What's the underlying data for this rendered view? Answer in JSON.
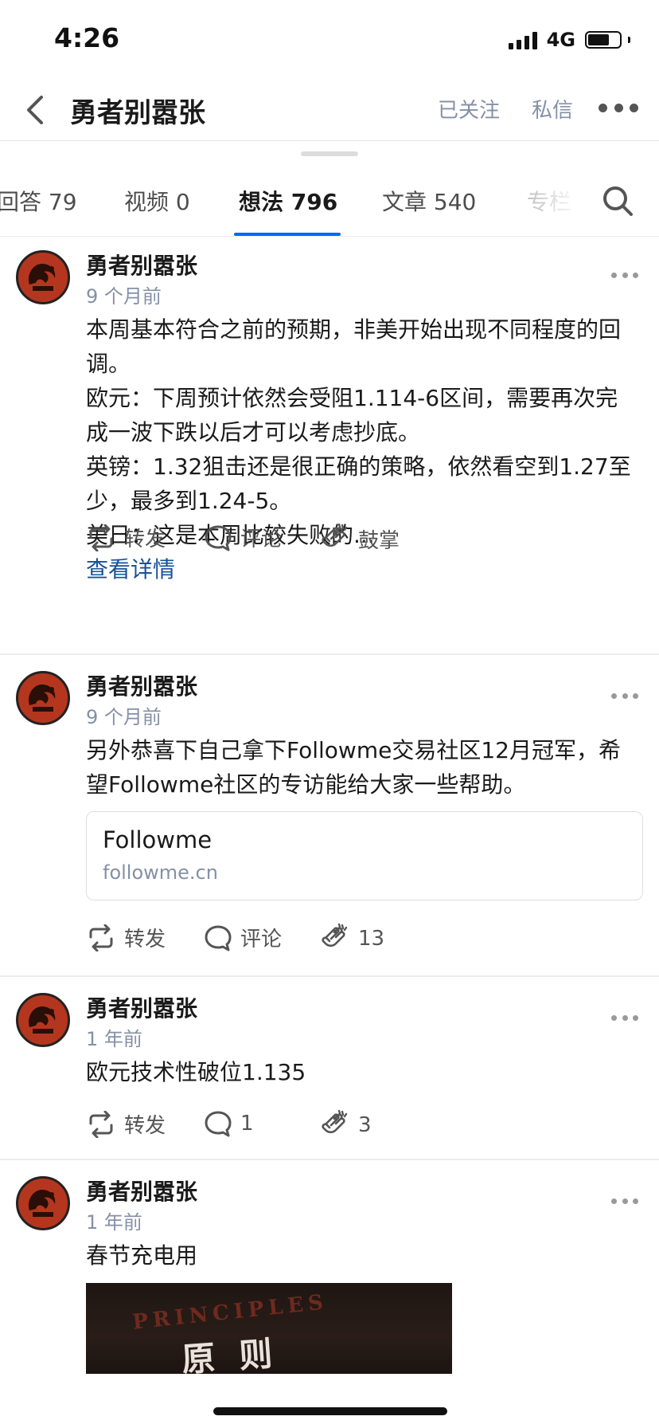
{
  "status_bar": {
    "time": "4:26",
    "network": "4G"
  },
  "nav": {
    "title": "勇者别嚣张",
    "followed_label": "已关注",
    "message_label": "私信"
  },
  "tabs": [
    {
      "label": "回答 79"
    },
    {
      "label": "视频 0"
    },
    {
      "label": "想法 796",
      "active": true
    },
    {
      "label": "文章 540"
    },
    {
      "label": "专栏"
    }
  ],
  "posts": [
    {
      "author": "勇者别嚣张",
      "time": "9 个月前",
      "lines": [
        "本周基本符合之前的预期，非美开始出现不同程度的回调。",
        "欧元：下周预计依然会受阻1.114-6区间，需要再次完成一波下跌以后才可以考虑抄底。",
        "英镑：1.32狙击还是很正确的策略，依然看空到1.27至少，最多到1.24-5。",
        "美日：这是本周比较失败的..."
      ],
      "see_more": "查看详情",
      "repost_label": "转发",
      "comment_label": "评论",
      "clap_label": "鼓掌"
    },
    {
      "author": "勇者别嚣张",
      "time": "9 个月前",
      "lines": [
        "另外恭喜下自己拿下Followme交易社区12月冠军，希望Followme社区的专访能给大家一些帮助。"
      ],
      "link_card": {
        "title": "Followme",
        "domain": "followme.cn"
      },
      "repost_label": "转发",
      "comment_label": "评论",
      "clap_label": "13"
    },
    {
      "author": "勇者别嚣张",
      "time": "1 年前",
      "lines": [
        "欧元技术性破位1.135"
      ],
      "repost_label": "转发",
      "comment_label": "1",
      "clap_label": "3"
    },
    {
      "author": "勇者别嚣张",
      "time": "1 年前",
      "lines": [
        "春节充电用"
      ],
      "image": {
        "banner_text": "PRINCIPLES",
        "title_text": "原则"
      }
    }
  ],
  "icons": {
    "back": "chevron-left-icon",
    "more": "more-horizontal-icon",
    "search": "search-icon",
    "repost": "repost-icon",
    "comment": "comment-icon",
    "clap": "clap-icon"
  },
  "colors": {
    "accent": "#0066ff",
    "link": "#175199",
    "muted": "#8590a6"
  }
}
